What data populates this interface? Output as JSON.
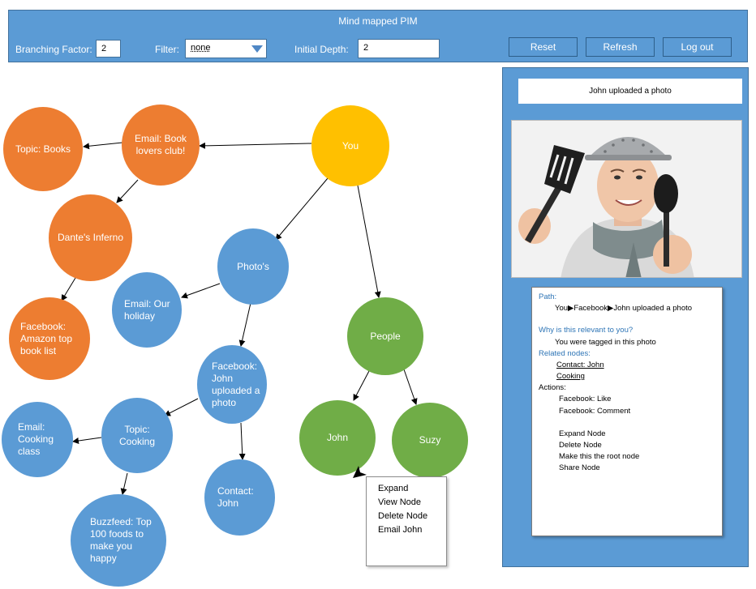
{
  "app": {
    "title": "Mind mapped PIM"
  },
  "toolbar": {
    "branching_label": "Branching Factor:",
    "branching_value": "2",
    "filter_label": "Filter:",
    "filter_value": "none",
    "depth_label": "Initial Depth:",
    "depth_value": "2",
    "reset_label": "Reset",
    "refresh_label": "Refresh",
    "logout_label": "Log out"
  },
  "nodes": {
    "you": "You",
    "email_book": "Email: Book lovers club!",
    "topic_books": "Topic: Books",
    "dantes": "Dante's Inferno",
    "fb_amazon": "Facebook: Amazon top book list",
    "photos": "Photo's",
    "email_holiday": "Email: Our holiday",
    "fb_john": "Facebook: John uploaded a photo",
    "topic_cooking": "Topic: Cooking",
    "email_cooking": "Email: Cooking class",
    "buzzfeed": "Buzzfeed: Top 100 foods to make you happy",
    "contact_john": "Contact: John",
    "people": "People",
    "john": "John",
    "suzy": "Suzy"
  },
  "context_menu": {
    "items": [
      "Expand",
      "View Node",
      "Delete Node",
      "Email John"
    ]
  },
  "side_panel": {
    "notification": "John uploaded a photo",
    "path_label": "Path:",
    "path_value": "You▶Facebook▶John uploaded a photo",
    "why_label": "Why is this relevant to you?",
    "why_value": "You were tagged in this photo",
    "related_label": "Related nodes:",
    "related": [
      "Contact: John",
      "Cooking"
    ],
    "actions_label": "Actions:",
    "actions": [
      "Facebook: Like",
      "Facebook: Comment",
      "Expand Node",
      "Delete Node",
      "Make this the root node",
      "Share Node"
    ]
  },
  "colors": {
    "toolbar": "#5b9bd5",
    "orange_node": "#ed7d31",
    "blue_node": "#5b9bd5",
    "root_node": "#ffc000",
    "people_node": "#70ad47",
    "section_header": "#2e75b6"
  },
  "icons": {
    "cursor": "mouse-pointer-icon",
    "dropdown": "chevron-down-icon"
  }
}
